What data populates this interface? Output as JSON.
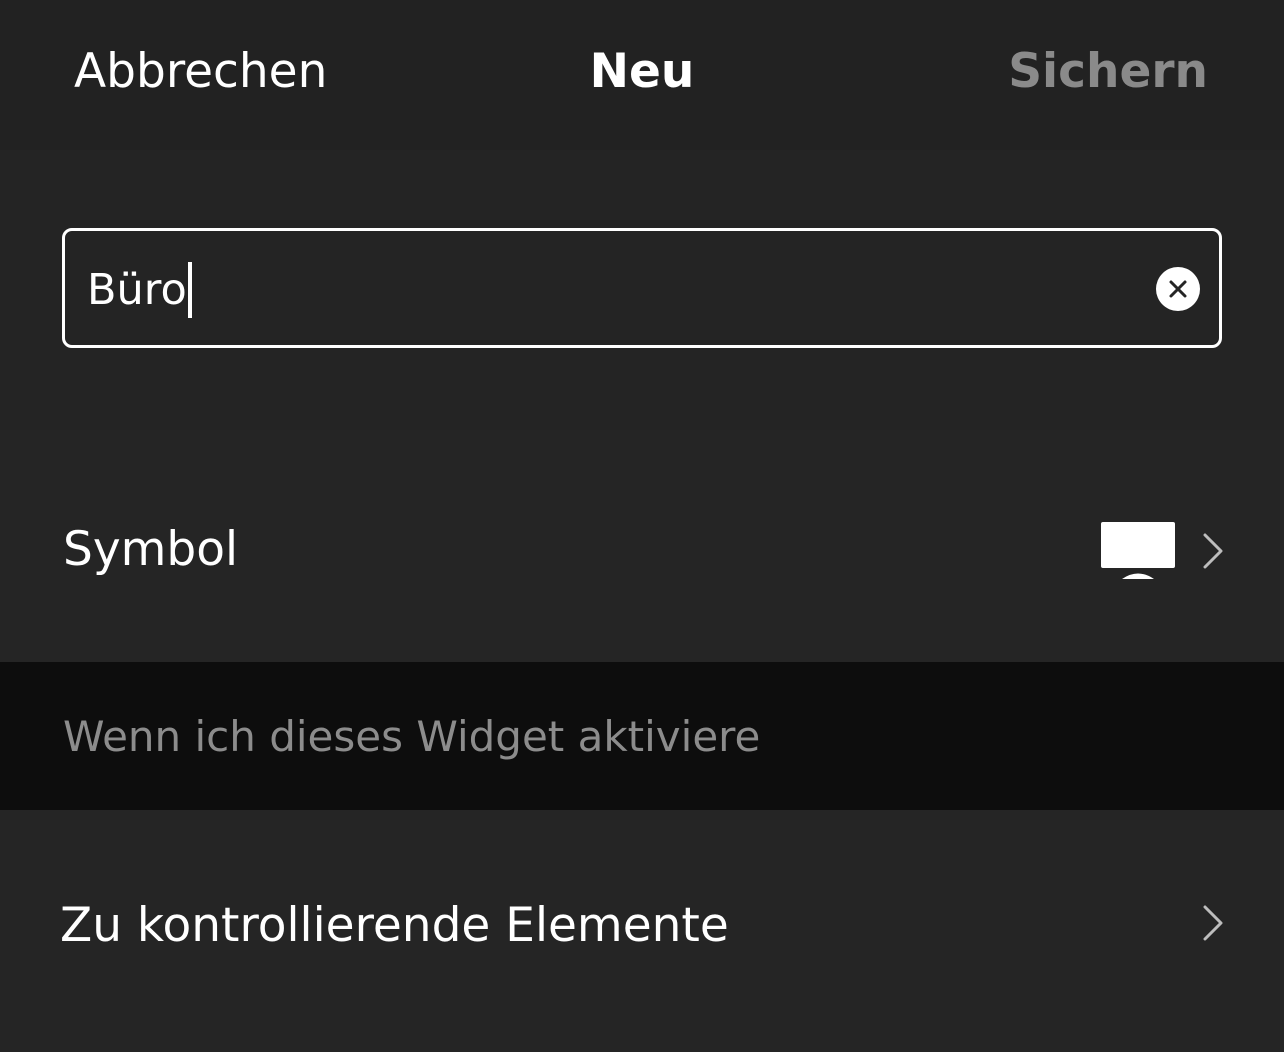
{
  "header": {
    "cancel_label": "Abbrechen",
    "title": "Neu",
    "save_label": "Sichern"
  },
  "name_field": {
    "value": "Büro",
    "clear_icon": "clear-circle-icon"
  },
  "symbol_row": {
    "label": "Symbol",
    "selected_icon": "monitor-icon",
    "chevron_icon": "chevron-right-icon"
  },
  "section_header": {
    "text": "Wenn ich dieses Widget aktiviere"
  },
  "controls_row": {
    "label": "Zu kontrollierende Elemente",
    "chevron_icon": "chevron-right-icon"
  },
  "colors": {
    "background": "#252525",
    "header_background": "#222222",
    "section_header_background": "#0d0d0d",
    "text_primary": "#ffffff",
    "text_disabled": "#8a8a8a",
    "text_secondary": "#8c8c8c"
  }
}
